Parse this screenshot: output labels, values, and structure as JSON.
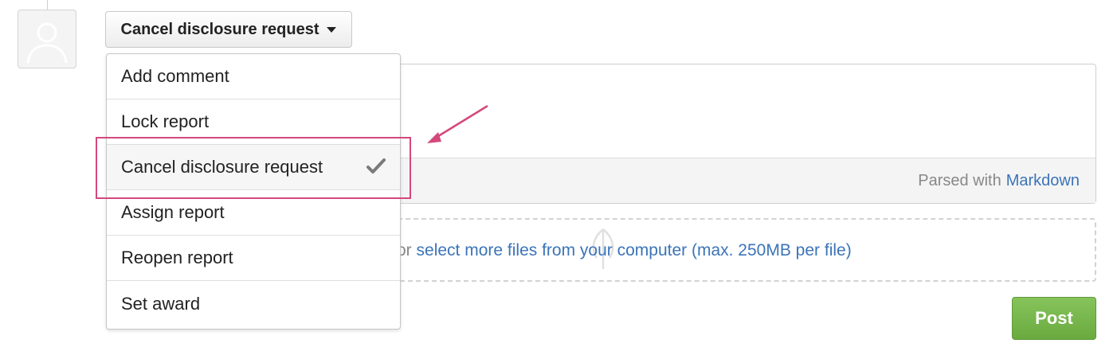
{
  "header": {
    "action_button_label": "Cancel disclosure request"
  },
  "dropdown": {
    "items": [
      {
        "label": "Add comment",
        "selected": false
      },
      {
        "label": "Lock report",
        "selected": false
      },
      {
        "label": "Cancel disclosure request",
        "selected": true
      },
      {
        "label": "Assign report",
        "selected": false
      },
      {
        "label": "Reopen report",
        "selected": false
      },
      {
        "label": "Set award",
        "selected": false
      }
    ]
  },
  "editor": {
    "parsed_with_text": "Parsed with",
    "markdown_link": "Markdown"
  },
  "dropzone": {
    "prefix": "or",
    "link_text": "select more files from your computer (max. 250MB per file)"
  },
  "post_button_label": "Post",
  "colors": {
    "annotation": "#d4487c",
    "link": "#3b74b8",
    "post_button": "#76b54a"
  },
  "icons": {
    "avatar": "user-silhouette-icon",
    "check": "check-icon",
    "upload": "upload-icon",
    "caret": "caret-down-icon",
    "annotation_arrow": "arrow-icon"
  }
}
